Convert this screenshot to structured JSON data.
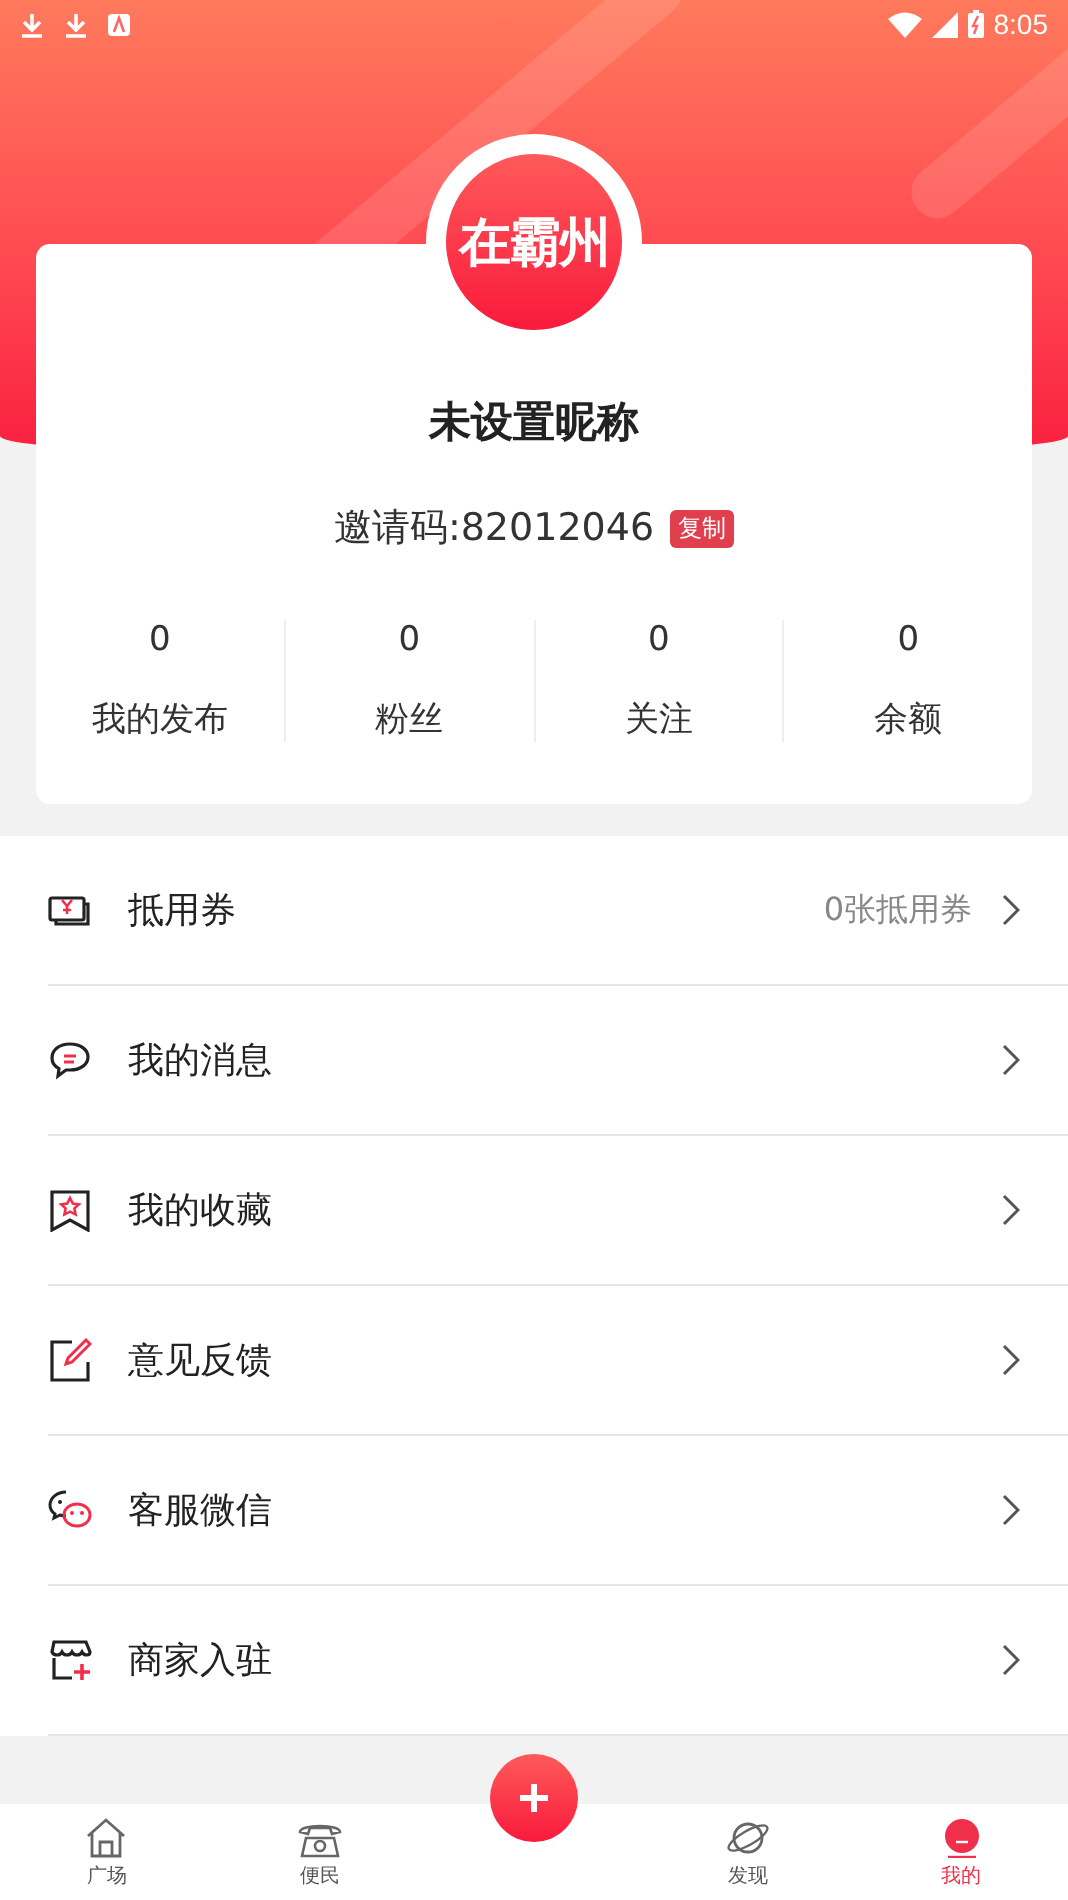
{
  "status_bar": {
    "time": "8:05"
  },
  "profile": {
    "logo_text": "在霸州",
    "nickname": "未设置昵称",
    "invite_code": "邀请码:82012046",
    "copy_button": "复制"
  },
  "stats": [
    {
      "value": "0",
      "label": "我的发布"
    },
    {
      "value": "0",
      "label": "粉丝"
    },
    {
      "value": "0",
      "label": "关注"
    },
    {
      "value": "0",
      "label": "余额"
    }
  ],
  "menu": [
    {
      "kind": "coupon",
      "label": "抵用券",
      "detail": "0张抵用券"
    },
    {
      "kind": "message",
      "label": "我的消息"
    },
    {
      "kind": "favorite",
      "label": "我的收藏"
    },
    {
      "kind": "feedback",
      "label": "意见反馈"
    },
    {
      "kind": "wechat",
      "label": "客服微信"
    },
    {
      "kind": "merchant",
      "label": "商家入驻"
    }
  ],
  "tabbar": [
    {
      "kind": "home",
      "label": "广场",
      "selected": false
    },
    {
      "kind": "phone",
      "label": "便民",
      "selected": false
    },
    {
      "kind": "add"
    },
    {
      "kind": "planet",
      "label": "发现",
      "selected": false
    },
    {
      "kind": "me",
      "label": "我的",
      "selected": true
    }
  ]
}
